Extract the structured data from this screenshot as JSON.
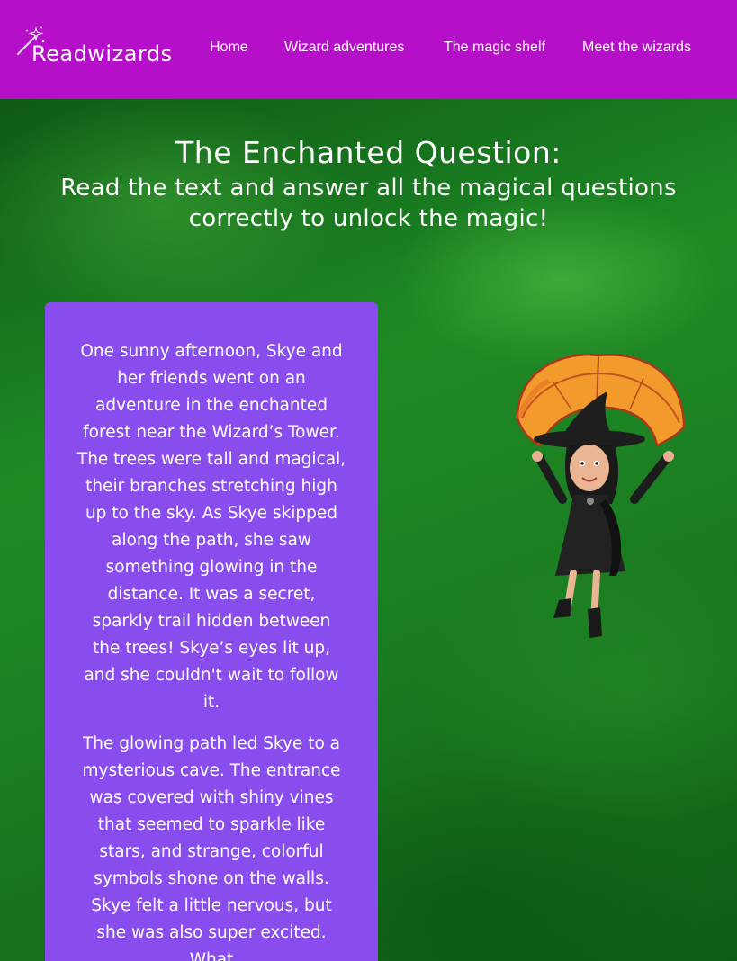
{
  "nav": {
    "brand": "Readwizards",
    "links": [
      "Home",
      "Wizard adventures",
      "The magic shelf",
      "Meet the wizards"
    ]
  },
  "header": {
    "title": "The Enchanted Question:",
    "subtitle": "Read the text and answer all the magical questions correctly to unlock the magic!"
  },
  "story": {
    "paragraphs": [
      "One sunny afternoon, Skye and her friends went on an adventure in the enchanted forest near the Wizard’s Tower. The trees were tall and magical, their branches stretching high up to the sky. As Skye skipped along the path, she saw something glowing in the distance. It was a secret, sparkly trail hidden between the trees! Skye’s eyes lit up, and she couldn't wait to follow it.",
      "The glowing path led Skye to a mysterious cave. The entrance was covered with shiny vines that seemed to sparkle like stars, and strange, colorful symbols shone on the walls. Skye felt a little nervous, but she was also super excited. What"
    ]
  },
  "colors": {
    "navbar": "#b60fc9",
    "card": "#8a4ded",
    "background": "#1a7a1e",
    "text": "#ffffff"
  },
  "icons": {
    "logo": "magic-wand-icon",
    "illustration": "witch-with-leaf-umbrella"
  }
}
